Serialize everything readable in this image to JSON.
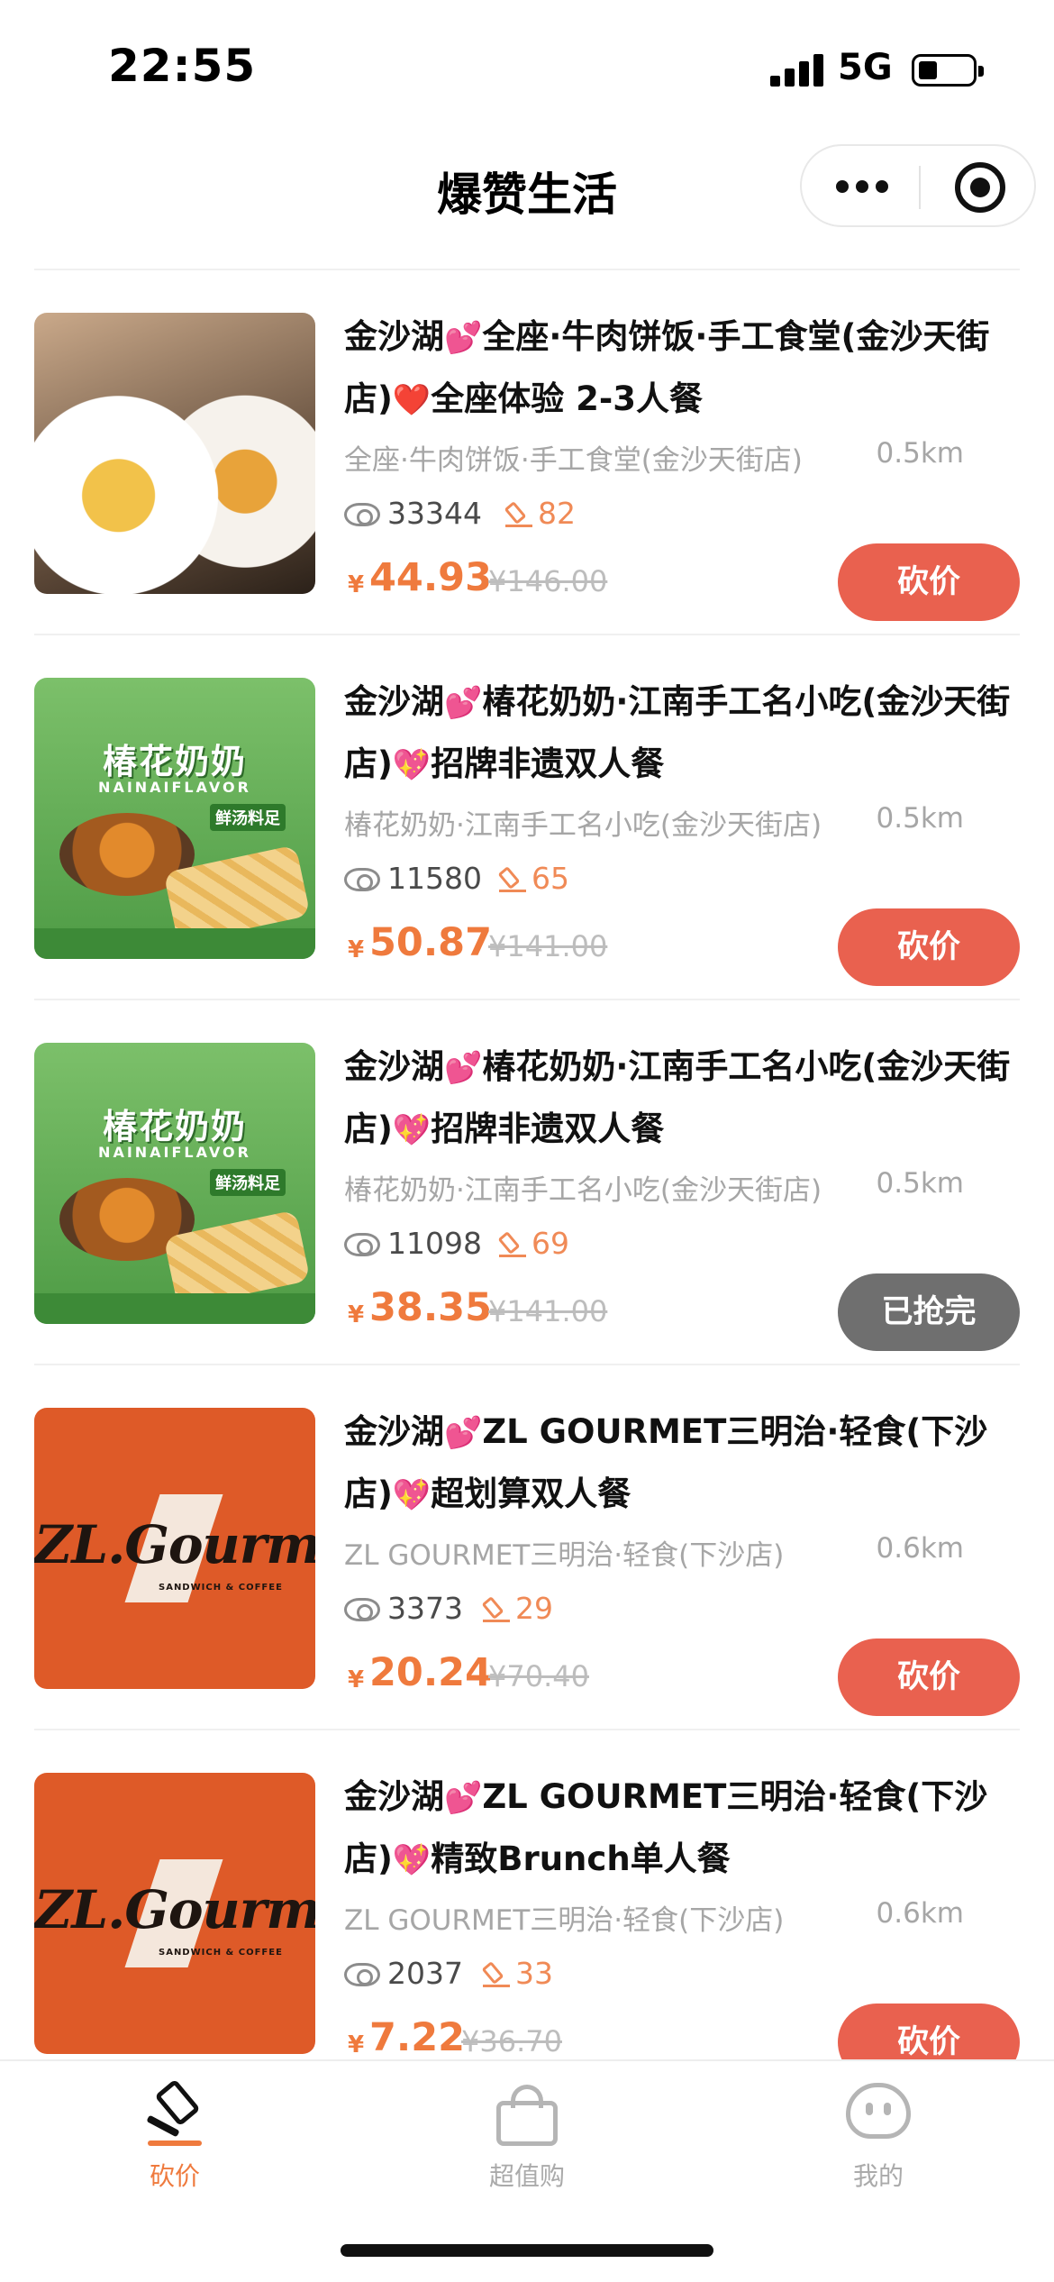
{
  "status_bar": {
    "time": "22:55",
    "network": "5G"
  },
  "nav": {
    "title": "爆赞生活"
  },
  "deals": [
    {
      "title_a": "金沙湖",
      "emoji_a": "💕",
      "title_b": "全座·牛肉饼饭·手工食堂(金沙天街店)",
      "emoji_b": "❤️",
      "title_c": "全座体验 2-3人餐",
      "store": "全座·牛肉饼饭·手工食堂(金沙天街店)",
      "distance": "0.5km",
      "views": "33344",
      "bids": "82",
      "yen": "¥",
      "price": "44.93",
      "original_price": "¥146.00",
      "button": "砍价",
      "thumb": "food"
    },
    {
      "title_a": "金沙湖",
      "emoji_a": "💕",
      "title_b": "椿花奶奶·江南手工名小吃(金沙天街店)",
      "emoji_b": "💖",
      "title_c": "招牌非遗双人餐",
      "store": "椿花奶奶·江南手工名小吃(金沙天街店)",
      "distance": "0.5km",
      "views": "11580",
      "bids": "65",
      "yen": "¥",
      "price": "50.87",
      "original_price": "¥141.00",
      "button": "砍价",
      "thumb": "green"
    },
    {
      "title_a": "金沙湖",
      "emoji_a": "💕",
      "title_b": "椿花奶奶·江南手工名小吃(金沙天街店)",
      "emoji_b": "💖",
      "title_c": "招牌非遗双人餐",
      "store": "椿花奶奶·江南手工名小吃(金沙天街店)",
      "distance": "0.5km",
      "views": "11098",
      "bids": "69",
      "yen": "¥",
      "price": "38.35",
      "original_price": "¥141.00",
      "button": "已抢完",
      "thumb": "green"
    },
    {
      "title_a": "金沙湖",
      "emoji_a": "💕",
      "title_b": "ZL GOURMET三明治·轻食(下沙店)",
      "emoji_b": "💖",
      "title_c": "超划算双人餐",
      "store": "ZL GOURMET三明治·轻食(下沙店)",
      "distance": "0.6km",
      "views": "3373",
      "bids": "29",
      "yen": "¥",
      "price": "20.24",
      "original_price": "¥70.40",
      "button": "砍价",
      "thumb": "zl"
    },
    {
      "title_a": "金沙湖",
      "emoji_a": "💕",
      "title_b": "ZL GOURMET三明治·轻食(下沙店)",
      "emoji_b": "💖",
      "title_c": "精致Brunch单人餐",
      "store": "ZL GOURMET三明治·轻食(下沙店)",
      "distance": "0.6km",
      "views": "2037",
      "bids": "33",
      "yen": "¥",
      "price": "7.22",
      "original_price": "¥36.70",
      "button": "砍价",
      "thumb": "zl"
    }
  ],
  "thumb_text": {
    "green_brand": "椿花奶奶",
    "green_sub": "NAINAIFLAVOR",
    "green_tag": "鲜汤料足",
    "zl_logo": "ZL.Gourmet",
    "zl_tagline": "SANDWICH & COFFEE"
  },
  "tabbar": {
    "tabs": [
      {
        "label": "砍价",
        "icon": "hammer-icon",
        "active": true
      },
      {
        "label": "超值购",
        "icon": "shopping-bag-icon",
        "active": false
      },
      {
        "label": "我的",
        "icon": "profile-face-icon",
        "active": false
      }
    ]
  },
  "colors": {
    "accent": "#ef7a3d",
    "button": "#e9614f",
    "soldout": "#6f6f6f",
    "muted": "#a6a6a6"
  }
}
